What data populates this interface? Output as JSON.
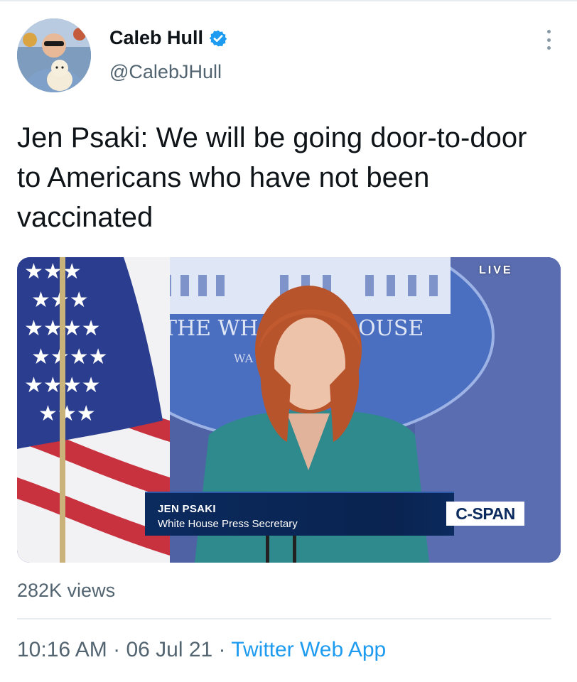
{
  "user": {
    "name": "Caleb Hull",
    "handle": "@CalebJHull",
    "verified": true,
    "avatar_icon": "profile-photo-with-dog"
  },
  "tweet": {
    "text": "Jen Psaki: We will be going door-to-door to Americans who have not been vaccinated"
  },
  "video": {
    "live_label": "LIVE",
    "backdrop_text_left": "THE WH",
    "backdrop_text_right": "OUSE",
    "backdrop_subtext": "WA",
    "lower_third_name": "JEN PSAKI",
    "lower_third_title": "White House Press Secretary",
    "network_logo": "C-SPAN"
  },
  "stats": {
    "views": "282K views"
  },
  "meta": {
    "time": "10:16 AM",
    "separator": " · ",
    "date": "06 Jul 21",
    "source": "Twitter Web App"
  },
  "colors": {
    "accent": "#1d9bf0",
    "secondary_text": "#536471",
    "primary_text": "#0f1419"
  }
}
